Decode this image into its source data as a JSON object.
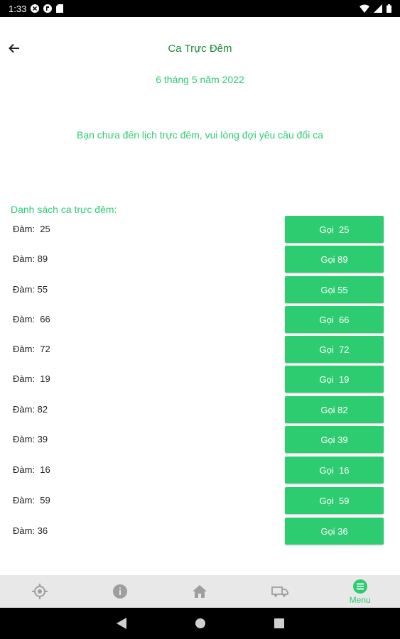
{
  "status_bar": {
    "time": "1:33"
  },
  "header": {
    "title": "Ca Trực Đêm"
  },
  "date": "6 tháng 5 năm 2022",
  "notice": "Bạn chưa đến lịch trực đêm, vui lòng đợi yêu cầu đổi ca",
  "list_title": "Danh sách ca trực đêm:",
  "rows": [
    {
      "label": "Đàm:  25",
      "button": "Gọi  25"
    },
    {
      "label": "Đàm: 89",
      "button": "Gọi 89"
    },
    {
      "label": "Đàm: 55",
      "button": "Gọi 55"
    },
    {
      "label": "Đàm:  66",
      "button": "Gọi  66"
    },
    {
      "label": "Đàm:  72",
      "button": "Gọi  72"
    },
    {
      "label": "Đàm:  19",
      "button": "Gọi  19"
    },
    {
      "label": "Đàm: 82",
      "button": "Gọi 82"
    },
    {
      "label": "Đàm: 39",
      "button": "Gọi 39"
    },
    {
      "label": "Đàm:  16",
      "button": "Gọi  16"
    },
    {
      "label": "Đàm:  59",
      "button": "Gọi  59"
    },
    {
      "label": "Đàm: 36",
      "button": "Gọi 36"
    }
  ],
  "bottom_nav": {
    "items": [
      {
        "icon": "location-icon"
      },
      {
        "icon": "info-icon"
      },
      {
        "icon": "home-icon"
      },
      {
        "icon": "ambulance-icon"
      },
      {
        "icon": "menu-icon",
        "label": "Menu"
      }
    ]
  },
  "colors": {
    "accent": "#2ecc71",
    "title": "#1b8a3a",
    "nav_bg": "#e8e8e8",
    "icon_gray": "#9e9e9e"
  }
}
